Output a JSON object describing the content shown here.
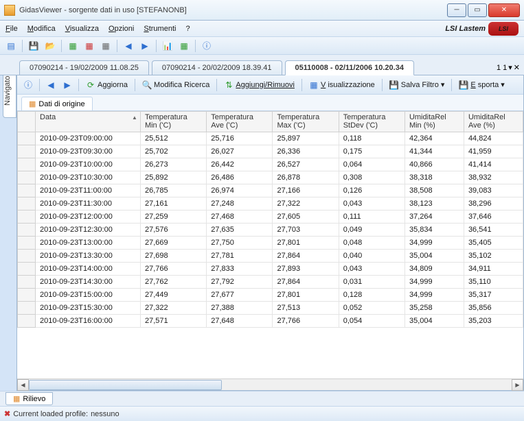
{
  "title": "GidasViewer - sorgente dati in uso  [STEFANONB]",
  "menubar": [
    "File",
    "Modifica",
    "Visualizza",
    "Opzioni",
    "Strumenti",
    "?"
  ],
  "brand": "LSI Lastem",
  "brand_logo": "LSI",
  "sidetab": "Navigatore",
  "doc_tabs": [
    {
      "label": "07090214 - 19/02/2009 11.08.25"
    },
    {
      "label": "07090214 - 20/02/2009 18.39.41"
    },
    {
      "label": "05110008 - 02/11/2006 10.20.34",
      "active": true
    }
  ],
  "tab_extra": "1 1",
  "toolbar2": {
    "aggiorna": "Aggiorna",
    "modifica_ricerca": "Modifica Ricerca",
    "aggiungi_rimuovi": "Aggiungi/Rimuovi",
    "visualizzazione": "Visualizzazione",
    "salva_filtro": "Salva Filtro",
    "esporta": "Esporta"
  },
  "subtab": "Dati di origine",
  "columns": [
    "Data",
    "Temperatura Min ('C)",
    "Temperatura Ave ('C)",
    "Temperatura Max ('C)",
    "Temperatura StDev ('C)",
    "UmiditaRel Min (%)",
    "UmiditaRel Ave (%)"
  ],
  "rows": [
    [
      "2010-09-23T09:00:00",
      "25,512",
      "25,716",
      "25,897",
      "0,118",
      "42,364",
      "44,824"
    ],
    [
      "2010-09-23T09:30:00",
      "25,702",
      "26,027",
      "26,336",
      "0,175",
      "41,344",
      "41,959"
    ],
    [
      "2010-09-23T10:00:00",
      "26,273",
      "26,442",
      "26,527",
      "0,064",
      "40,866",
      "41,414"
    ],
    [
      "2010-09-23T10:30:00",
      "25,892",
      "26,486",
      "26,878",
      "0,308",
      "38,318",
      "38,932"
    ],
    [
      "2010-09-23T11:00:00",
      "26,785",
      "26,974",
      "27,166",
      "0,126",
      "38,508",
      "39,083"
    ],
    [
      "2010-09-23T11:30:00",
      "27,161",
      "27,248",
      "27,322",
      "0,043",
      "38,123",
      "38,296"
    ],
    [
      "2010-09-23T12:00:00",
      "27,259",
      "27,468",
      "27,605",
      "0,111",
      "37,264",
      "37,646"
    ],
    [
      "2010-09-23T12:30:00",
      "27,576",
      "27,635",
      "27,703",
      "0,049",
      "35,834",
      "36,541"
    ],
    [
      "2010-09-23T13:00:00",
      "27,669",
      "27,750",
      "27,801",
      "0,048",
      "34,999",
      "35,405"
    ],
    [
      "2010-09-23T13:30:00",
      "27,698",
      "27,781",
      "27,864",
      "0,040",
      "35,004",
      "35,102"
    ],
    [
      "2010-09-23T14:00:00",
      "27,766",
      "27,833",
      "27,893",
      "0,043",
      "34,809",
      "34,911"
    ],
    [
      "2010-09-23T14:30:00",
      "27,762",
      "27,792",
      "27,864",
      "0,031",
      "34,999",
      "35,110"
    ],
    [
      "2010-09-23T15:00:00",
      "27,449",
      "27,677",
      "27,801",
      "0,128",
      "34,999",
      "35,317"
    ],
    [
      "2010-09-23T15:30:00",
      "27,322",
      "27,388",
      "27,513",
      "0,052",
      "35,258",
      "35,856"
    ],
    [
      "2010-09-23T16:00:00",
      "27,571",
      "27,648",
      "27,766",
      "0,054",
      "35,004",
      "35,203"
    ]
  ],
  "bottom_tab": "Rilievo",
  "status": {
    "prefix": "Current loaded profile:",
    "value": "nessuno"
  }
}
